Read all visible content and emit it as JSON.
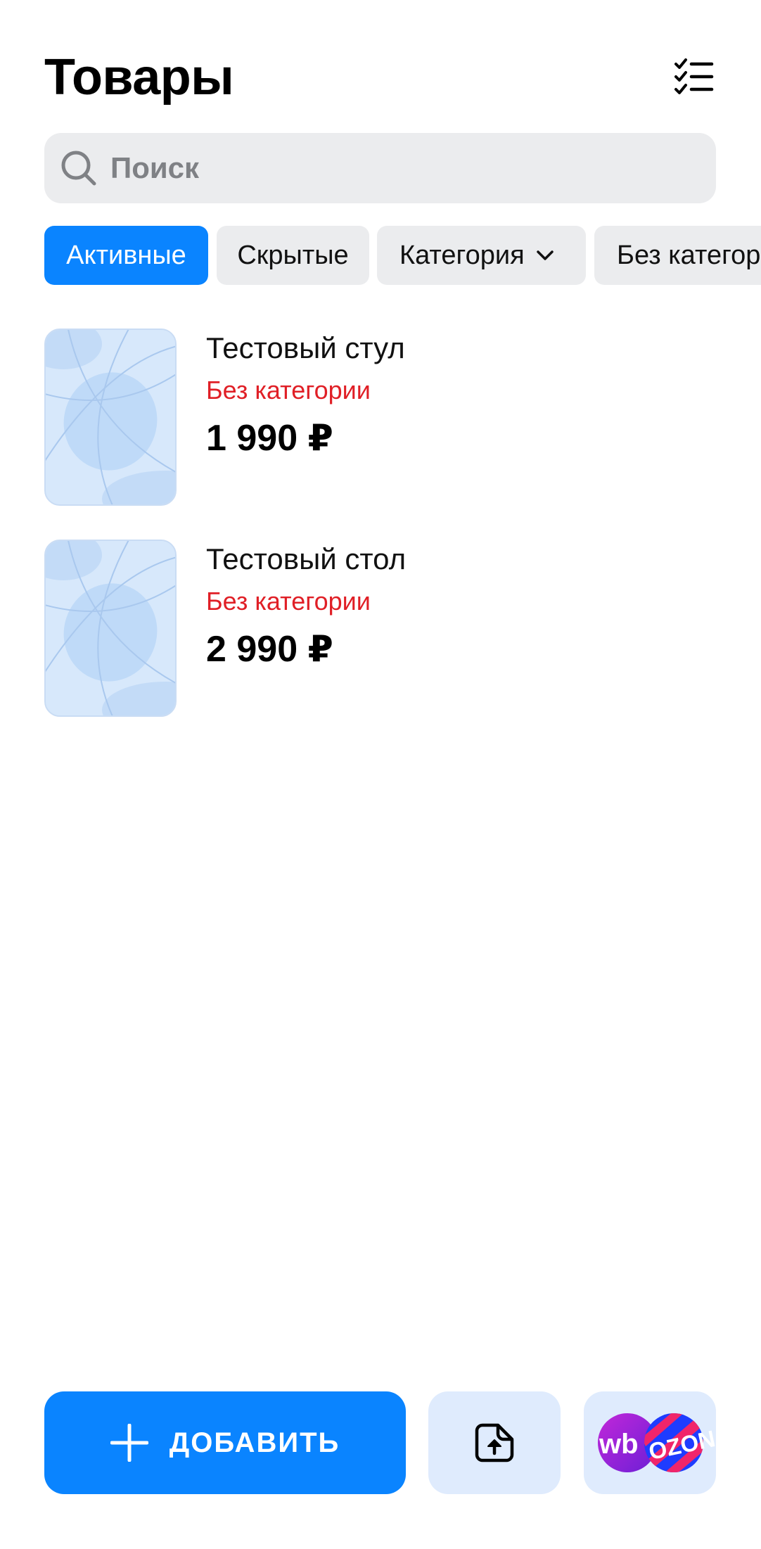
{
  "header": {
    "title": "Товары"
  },
  "search": {
    "placeholder": "Поиск",
    "value": ""
  },
  "filters": [
    {
      "label": "Активные",
      "active": true
    },
    {
      "label": "Скрытые",
      "active": false
    },
    {
      "label": "Категория",
      "active": false,
      "dropdown": true
    },
    {
      "label": "Без категории",
      "active": false
    }
  ],
  "products": [
    {
      "name": "Тестовый стул",
      "category": "Без категории",
      "price": "1 990 ₽"
    },
    {
      "name": "Тестовый стол",
      "category": "Без категории",
      "price": "2 990 ₽"
    }
  ],
  "bottom_bar": {
    "add_label": "ДОБАВИТЬ",
    "marketplaces_logo_text": [
      "wb",
      "OZON"
    ]
  },
  "colors": {
    "accent": "#0a84ff",
    "chip_bg": "#ebecee",
    "category_red": "#e01f26",
    "secondary_btn_bg": "#dfebfd"
  },
  "icons": {
    "header_action": "checklist-icon",
    "search": "search-icon",
    "dropdown": "chevron-down-icon",
    "add": "plus-icon",
    "import": "file-upload-icon"
  }
}
